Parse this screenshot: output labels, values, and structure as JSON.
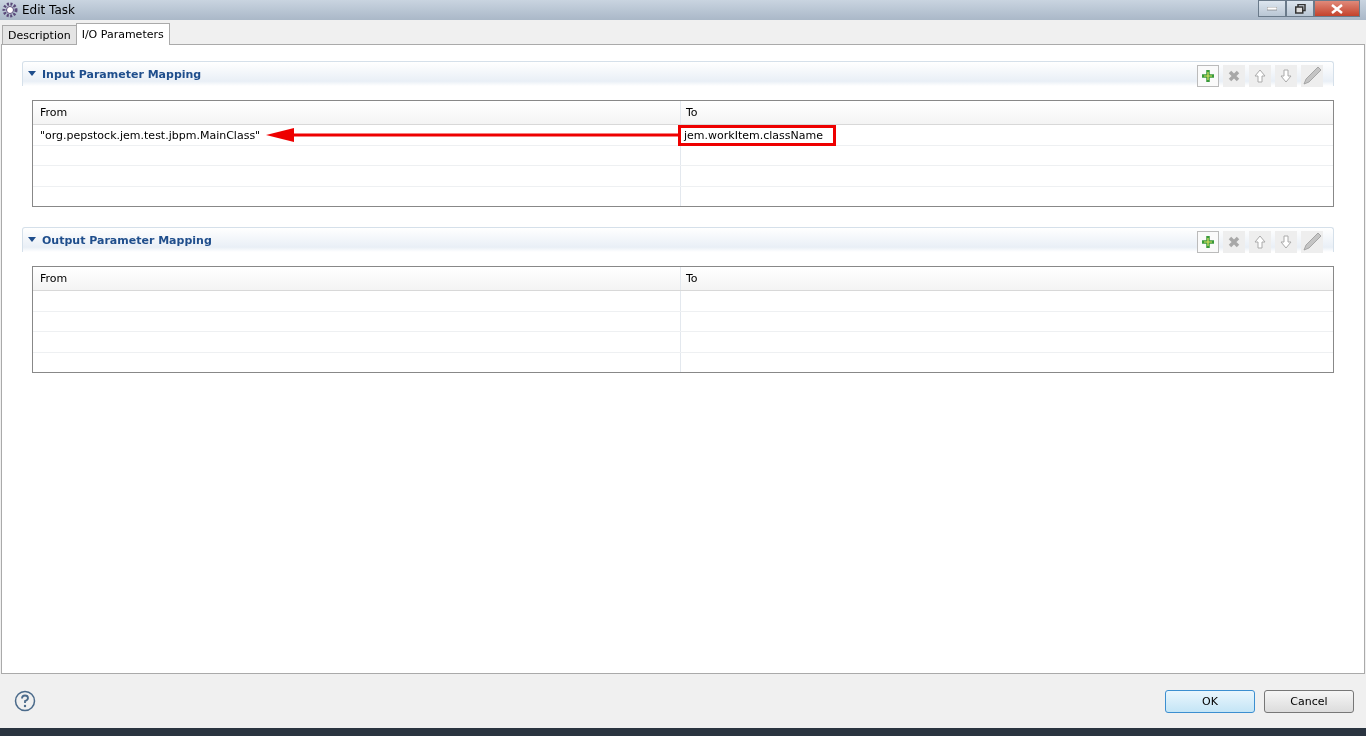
{
  "window": {
    "title": "Edit Task"
  },
  "tabs": [
    {
      "label": "Description",
      "selected": false
    },
    {
      "label": "I/O Parameters",
      "selected": true
    }
  ],
  "sections": [
    {
      "title": "Input Parameter Mapping",
      "expanded": true,
      "tools": [
        {
          "kind": "add",
          "disabled": false
        },
        {
          "kind": "delete",
          "disabled": true
        },
        {
          "kind": "up",
          "disabled": true
        },
        {
          "kind": "down",
          "disabled": true
        },
        {
          "kind": "edit",
          "disabled": true
        }
      ],
      "columns": [
        "From",
        "To"
      ],
      "rows": [
        {
          "from": "\"org.pepstock.jem.test.jbpm.MainClass\"",
          "to": "jem.workItem.className",
          "highlighted": true
        }
      ]
    },
    {
      "title": "Output Parameter Mapping",
      "expanded": true,
      "tools": [
        {
          "kind": "add",
          "disabled": false
        },
        {
          "kind": "delete",
          "disabled": true
        },
        {
          "kind": "up",
          "disabled": true
        },
        {
          "kind": "down",
          "disabled": true
        },
        {
          "kind": "edit",
          "disabled": true
        }
      ],
      "columns": [
        "From",
        "To"
      ]
    }
  ],
  "buttons": [
    {
      "label": "OK",
      "default": true
    },
    {
      "label": "Cancel",
      "default": false
    }
  ]
}
